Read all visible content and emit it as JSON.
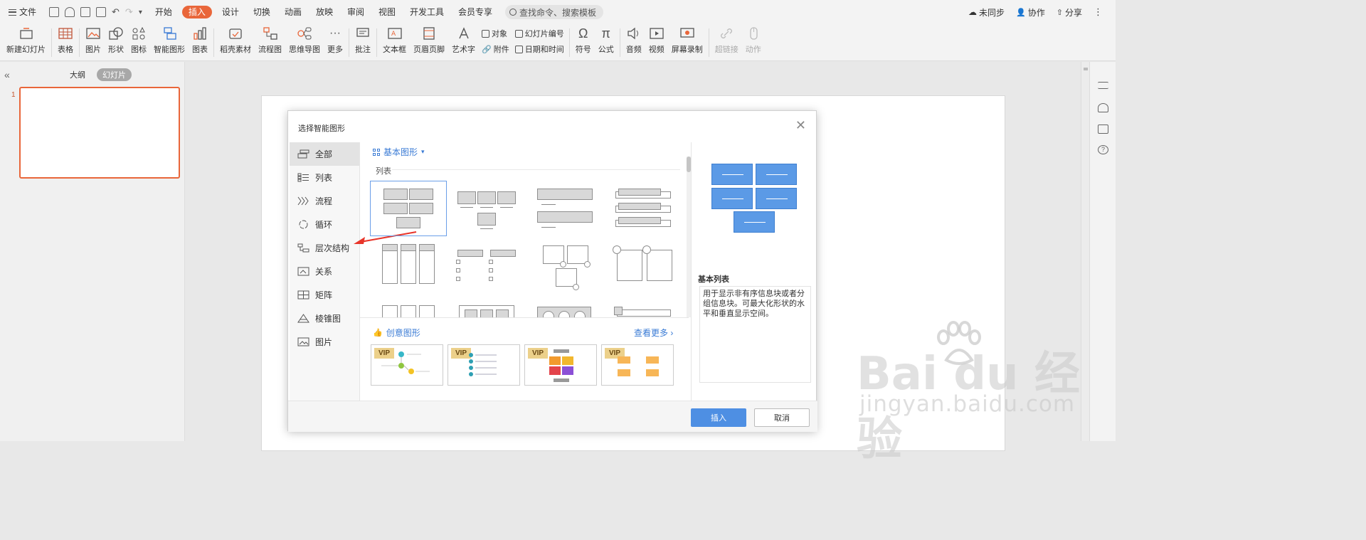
{
  "topbar": {
    "file": "文件",
    "tabs": [
      "开始",
      "插入",
      "设计",
      "切换",
      "动画",
      "放映",
      "审阅",
      "视图",
      "开发工具",
      "会员专享"
    ],
    "search": "查找命令、搜索模板",
    "sync": "未同步",
    "collab": "协作",
    "share": "分享"
  },
  "ribbon": {
    "new_slide": "新建幻灯片",
    "table": "表格",
    "picture": "图片",
    "shape": "形状",
    "icon": "图标",
    "smartart": "智能图形",
    "chart": "图表",
    "material": "稻壳素材",
    "flow": "流程图",
    "mindmap": "思维导图",
    "more": "更多",
    "comment": "批注",
    "textbox": "文本框",
    "headerfooter": "页眉页脚",
    "wordart": "艺术字",
    "object": "对象",
    "attach": "附件",
    "slide_num": "幻灯片编号",
    "datetime": "日期和时间",
    "symbol": "符号",
    "formula": "公式",
    "audio": "音频",
    "video": "视频",
    "record": "屏幕录制",
    "hyperlink": "超链接",
    "action": "动作"
  },
  "leftpane": {
    "tab_outline": "大纲",
    "tab_slides": "幻灯片",
    "slide_number": "1"
  },
  "dialog": {
    "title": "选择智能图形",
    "categories": [
      "全部",
      "列表",
      "流程",
      "循环",
      "层次结构",
      "关系",
      "矩阵",
      "棱锥图",
      "图片"
    ],
    "selected_category": "全部",
    "gallery_header": "基本图形",
    "gallery_section": "列表",
    "creative_header": "创意图形",
    "see_more": "查看更多",
    "vip_badge": "VIP",
    "preview_title": "基本列表",
    "preview_desc": "用于显示非有序信息块或者分组信息块。可最大化形状的水平和垂直显示空间。",
    "insert": "插入",
    "cancel": "取消"
  },
  "watermark": {
    "brand": "Bai du 经验",
    "url": "jingyan.baidu.com"
  },
  "colors": {
    "accent": "#e9663a",
    "blue": "#4e8fe3",
    "preview_block": "#5b9ae6"
  }
}
